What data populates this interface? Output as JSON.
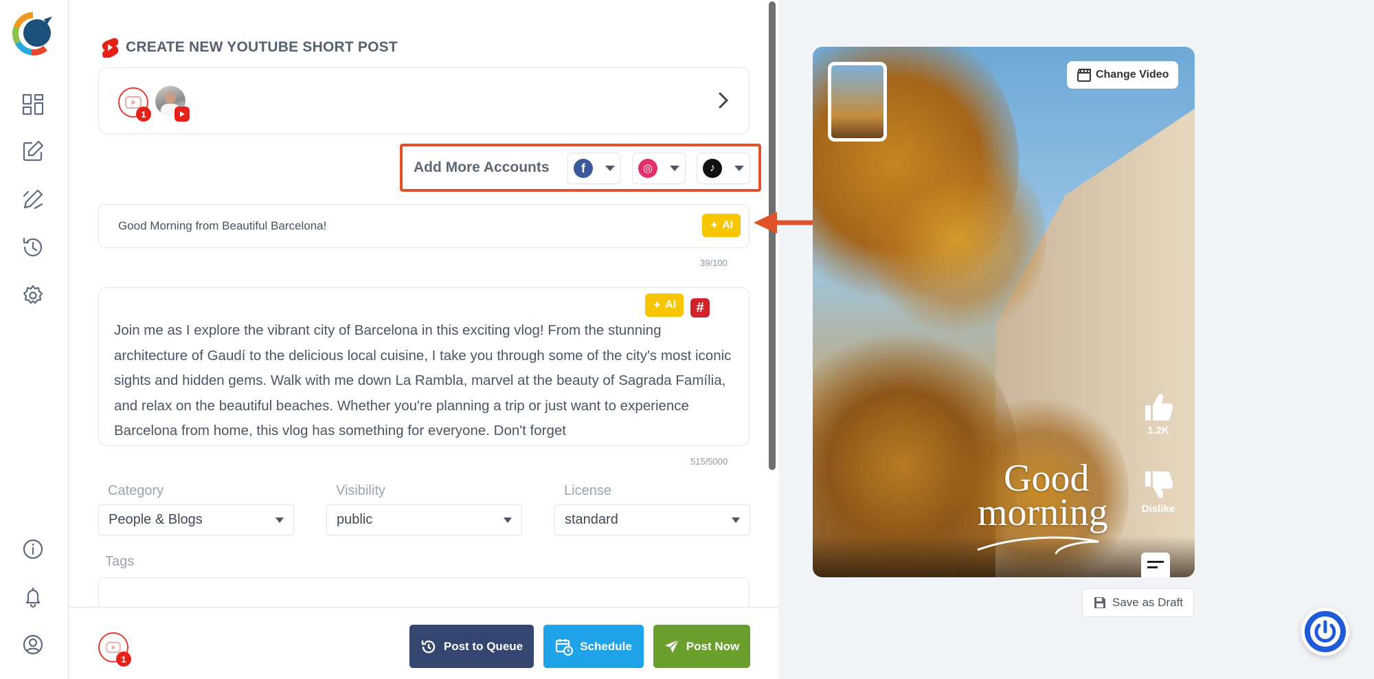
{
  "sidebar": {
    "nav": [
      "dashboard-icon",
      "compose-icon",
      "edit-post-icon",
      "history-icon",
      "settings-icon"
    ],
    "bottom": [
      "info-icon",
      "bell-icon",
      "user-icon"
    ]
  },
  "header": {
    "title": "CREATE NEW YOUTUBE SHORT POST"
  },
  "accounts": {
    "selected_count": "1",
    "avatar_badge": "youtube"
  },
  "add_more": {
    "label": "Add More Accounts",
    "networks": [
      {
        "name": "facebook",
        "glyph": "f",
        "color": "#3b5998"
      },
      {
        "name": "instagram",
        "glyph": "◎",
        "color": "#e1306c"
      },
      {
        "name": "tiktok",
        "glyph": "♪",
        "color": "#111111"
      }
    ]
  },
  "title_input": {
    "value": "Good Morning from Beautiful Barcelona!",
    "counter": "39/100",
    "ai_label": "AI"
  },
  "description": {
    "text": "Join me as I explore the vibrant city of Barcelona in this exciting vlog! From the stunning architecture of Gaudí to the delicious local cuisine, I take you through some of the city's most iconic sights and hidden gems. Walk with me down La Rambla, marvel at the beauty of Sagrada Família, and relax on the beautiful beaches. Whether you're planning a trip or just want to experience Barcelona from home, this vlog has something for everyone. Don't forget",
    "counter": "515/5000",
    "ai_label": "AI",
    "hashtag_label": "#"
  },
  "fields": {
    "category": {
      "label": "Category",
      "value": "People & Blogs"
    },
    "visibility": {
      "label": "Visibility",
      "value": "public"
    },
    "license": {
      "label": "License",
      "value": "standard"
    },
    "tags": {
      "label": "Tags",
      "value": ""
    }
  },
  "footer": {
    "selected_count": "1",
    "post_to_queue": "Post to Queue",
    "schedule": "Schedule",
    "post_now": "Post Now"
  },
  "preview": {
    "change_video": "Change Video",
    "overlay_line1": "Good",
    "overlay_line2": "morning",
    "likes": "1.2K",
    "dislike": "Dislike"
  },
  "save_draft": "Save as Draft",
  "colors": {
    "accent_orange": "#e0532a",
    "queue_btn": "#34466f",
    "schedule_btn": "#1fa3e8",
    "post_now_btn": "#6a9e2d",
    "ai_yellow": "#f7c600",
    "youtube_red": "#e62117"
  }
}
